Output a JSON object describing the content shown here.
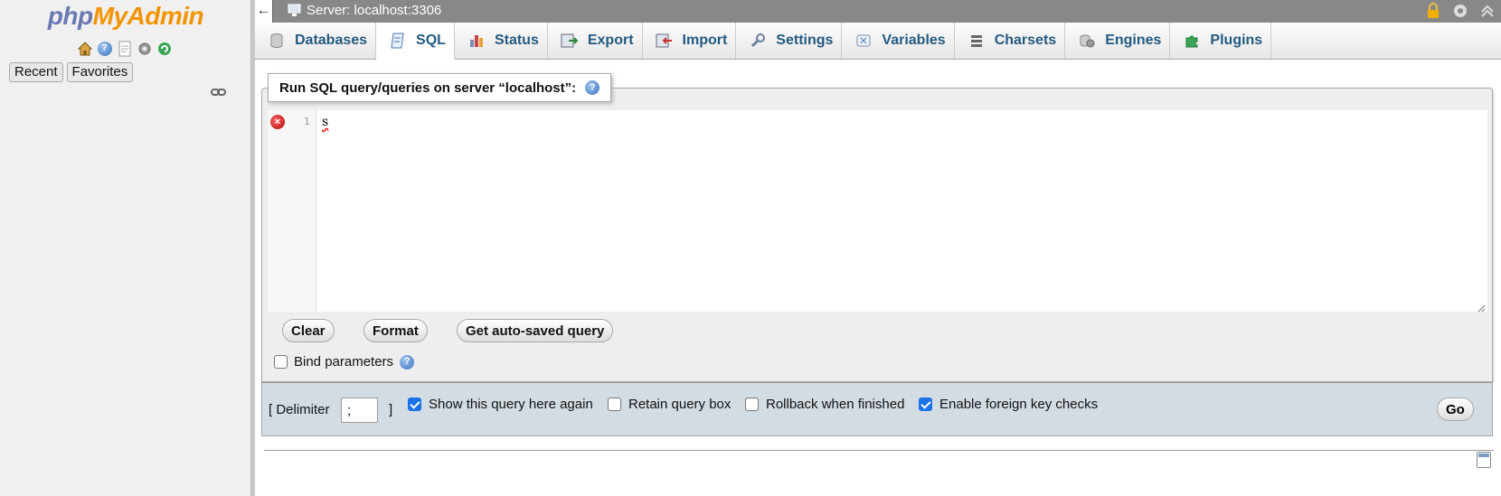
{
  "nav": {
    "logo_php": "php",
    "logo_my": "My",
    "logo_admin": "Admin",
    "icons": [
      "home-icon",
      "help-icon",
      "docs-icon",
      "settings-icon",
      "reload-icon"
    ],
    "tabs": [
      {
        "label": "Recent"
      },
      {
        "label": "Favorites"
      }
    ]
  },
  "topbar": {
    "back": "←",
    "server": "Server: localhost:3306",
    "right_icons": [
      "lock-icon",
      "gear-icon",
      "collapse-icon"
    ]
  },
  "menu": {
    "tabs": [
      {
        "label": "Databases",
        "icon": "database-icon",
        "active": false
      },
      {
        "label": "SQL",
        "icon": "sql-icon",
        "active": true
      },
      {
        "label": "Status",
        "icon": "status-icon",
        "active": false
      },
      {
        "label": "Export",
        "icon": "export-icon",
        "active": false
      },
      {
        "label": "Import",
        "icon": "import-icon",
        "active": false
      },
      {
        "label": "Settings",
        "icon": "wrench-icon",
        "active": false
      },
      {
        "label": "Variables",
        "icon": "variables-icon",
        "active": false
      },
      {
        "label": "Charsets",
        "icon": "charsets-icon",
        "active": false
      },
      {
        "label": "Engines",
        "icon": "engines-icon",
        "active": false
      },
      {
        "label": "Plugins",
        "icon": "plugin-icon",
        "active": false
      }
    ]
  },
  "query": {
    "legend": "Run SQL query/queries on server “localhost”:",
    "line_number": "1",
    "code": "s",
    "buttons": {
      "clear": "Clear",
      "format": "Format",
      "autosaved": "Get auto-saved query"
    },
    "bind_parameters": "Bind parameters"
  },
  "options": {
    "delimiter_label": "[ Delimiter",
    "delimiter_value": ";",
    "delimiter_close": "]",
    "show_query": {
      "label": "Show this query here again",
      "checked": true
    },
    "retain_box": {
      "label": "Retain query box",
      "checked": false
    },
    "rollback": {
      "label": "Rollback when finished",
      "checked": false
    },
    "foreign_keys": {
      "label": "Enable foreign key checks",
      "checked": true
    },
    "go": "Go"
  },
  "colors": {
    "link": "#235a81",
    "logo_blue": "#6c78b4",
    "logo_orange": "#f29400",
    "options_bg": "#d3dce3"
  }
}
